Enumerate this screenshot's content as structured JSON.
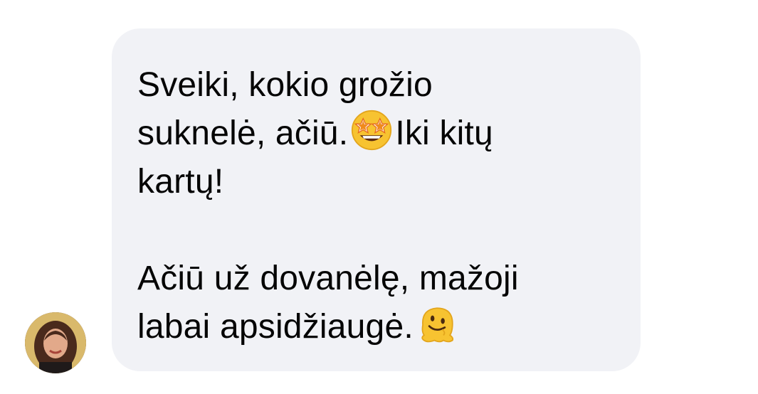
{
  "conversation": {
    "messages": [
      {
        "line1": "Sveiki, kokio grožio",
        "line2_a": "suknelė, ačiū.",
        "line2_emoji": "star-struck-emoji",
        "line2_b": "Iki kitų",
        "line3": "kartų!"
      },
      {
        "line1": "Ačiū už dovanėlę, mažoji",
        "line2_a": "labai apsidžiaugė.",
        "line2_emoji": "melting-face-emoji"
      }
    ]
  },
  "colors": {
    "bubble": "#f1f2f6",
    "text": "#050505",
    "emoji": "#f7c331"
  }
}
